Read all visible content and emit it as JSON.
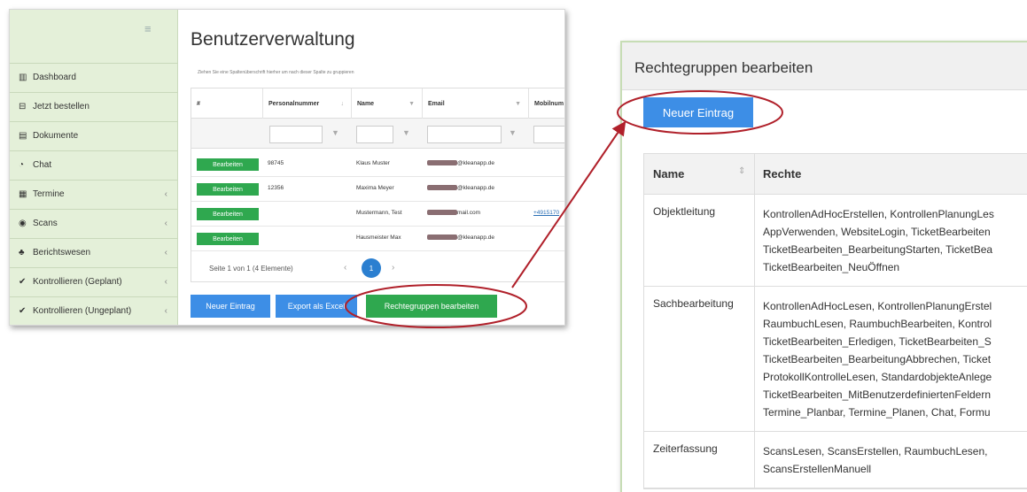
{
  "left": {
    "sidebar": {
      "items": [
        {
          "icon": "bar-chart-icon",
          "glyph": "▥",
          "label": "Dashboard",
          "chevron": false
        },
        {
          "icon": "basket-icon",
          "glyph": "⊟",
          "label": "Jetzt bestellen",
          "chevron": false
        },
        {
          "icon": "document-icon",
          "glyph": "▤",
          "label": "Dokumente",
          "chevron": false
        },
        {
          "icon": "chat-icon",
          "glyph": "◔",
          "label": "Chat",
          "chevron": false
        },
        {
          "icon": "calendar-icon",
          "glyph": "▦",
          "label": "Termine",
          "chevron": true
        },
        {
          "icon": "scan-icon",
          "glyph": "◉",
          "label": "Scans",
          "chevron": true
        },
        {
          "icon": "reports-icon",
          "glyph": "♣",
          "label": "Berichtswesen",
          "chevron": true
        },
        {
          "icon": "check-icon",
          "glyph": "✔",
          "label": "Kontrollieren (Geplant)",
          "chevron": true
        },
        {
          "icon": "check-icon",
          "glyph": "✔",
          "label": "Kontrollieren (Ungeplant)",
          "chevron": true
        }
      ]
    },
    "title": "Benutzerverwaltung",
    "group_hint": "Ziehen Sie eine Spaltenüberschrift hierher um nach dieser Spalte zu gruppieren",
    "columns": [
      "#",
      "Personalnummer",
      "Name",
      "Email",
      "Mobilnum"
    ],
    "rows": [
      {
        "edit": "Bearbeiten",
        "personalnummer": "98745",
        "name": "Klaus Muster",
        "email_suffix": "@kleanapp.de",
        "mobile": ""
      },
      {
        "edit": "Bearbeiten",
        "personalnummer": "12356",
        "name": "Maxima Meyer",
        "email_suffix": "@kleanapp.de",
        "mobile": ""
      },
      {
        "edit": "Bearbeiten",
        "personalnummer": "",
        "name": "Mustermann, Test",
        "email_suffix": "mail.com",
        "mobile": "+4915170"
      },
      {
        "edit": "Bearbeiten",
        "personalnummer": "",
        "name": "Hausmeister Max",
        "email_suffix": "@kleanapp.de",
        "mobile": ""
      }
    ],
    "pager": {
      "text": "Seite 1 von 1 (4 Elemente)",
      "page": "1"
    },
    "buttons": {
      "new": "Neuer Eintrag",
      "export": "Export als Excel",
      "rights": "Rechtegruppen bearbeiten"
    }
  },
  "right": {
    "title": "Rechtegruppen bearbeiten",
    "new_button": "Neuer Eintrag",
    "headers": {
      "name": "Name",
      "rights": "Rechte"
    },
    "groups": [
      {
        "name": "Objektleitung",
        "rights": [
          "KontrollenAdHocErstellen, KontrollenPlanungLes",
          "AppVerwenden, WebsiteLogin, TicketBearbeiten",
          "TicketBearbeiten_BearbeitungStarten, TicketBea",
          "TicketBearbeiten_NeuÖffnen"
        ]
      },
      {
        "name": "Sachbearbeitung",
        "rights": [
          "KontrollenAdHocLesen, KontrollenPlanungErstel",
          "RaumbuchLesen, RaumbuchBearbeiten, Kontrol",
          "TicketBearbeiten_Erledigen, TicketBearbeiten_S",
          "TicketBearbeiten_BearbeitungAbbrechen, Ticket",
          "ProtokollKontrolleLesen, StandardobjekteAnlege",
          "TicketBearbeiten_MitBenutzerdefiniertenFeldern",
          "Termine_Planbar, Termine_Planen, Chat, Formu"
        ]
      },
      {
        "name": "Zeiterfassung",
        "rights": [
          "ScansLesen, ScansErstellen, RaumbuchLesen, ",
          "ScansErstellenManuell"
        ]
      }
    ]
  },
  "colors": {
    "sidebar": "#e4f0d9",
    "green_button": "#2fa84f",
    "blue_button": "#3d8ee6",
    "highlight": "#b0202a"
  }
}
